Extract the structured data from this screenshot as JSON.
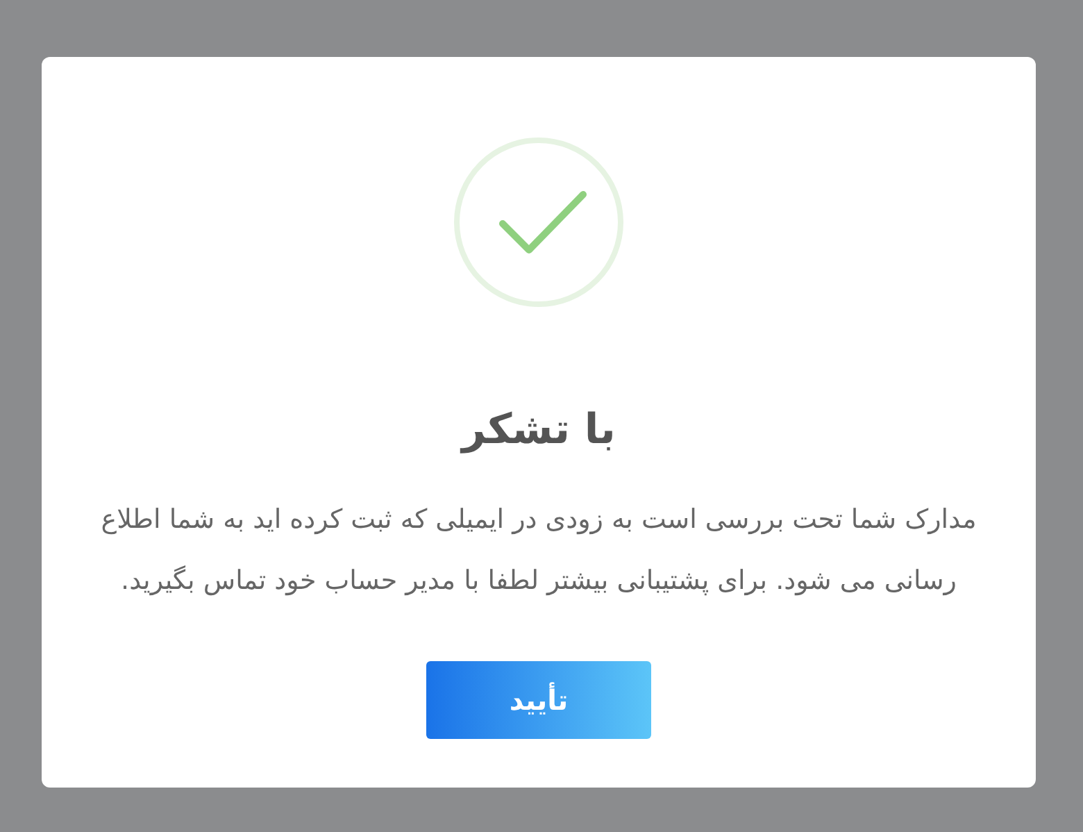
{
  "dialog": {
    "title": "با تشکر",
    "message": "مدارک شما تحت بررسی است به زودی در ایمیلی که ثبت کرده اید به شما اطلاع رسانی می شود. برای پشتیبانی بیشتر لطفا با مدیر حساب خود تماس بگیرید.",
    "button": "تأیید"
  }
}
